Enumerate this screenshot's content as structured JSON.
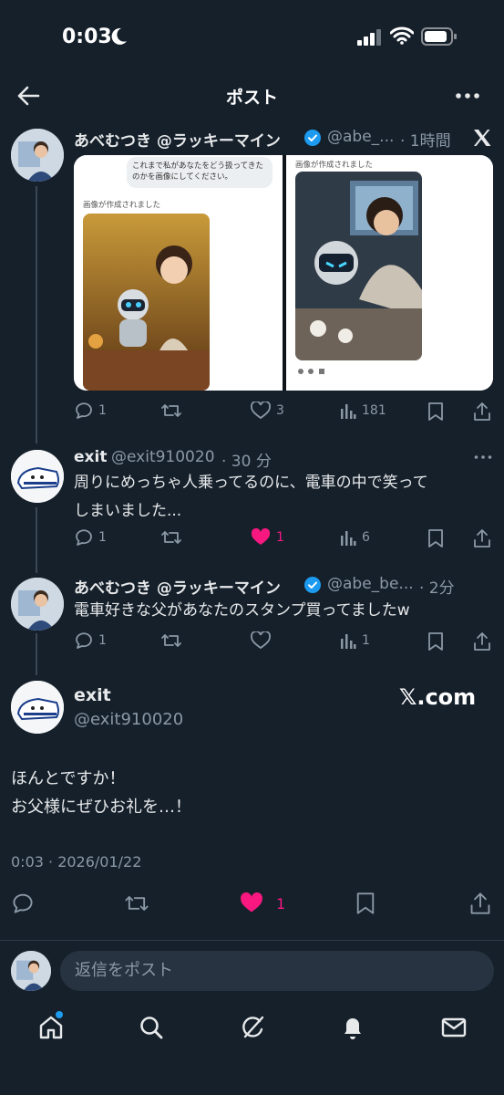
{
  "status_bar": {
    "time": "0:03"
  },
  "header": {
    "title": "ポスト"
  },
  "tweets": [
    {
      "name": "あべむつき @ラッキーマイン",
      "handle": "@abe_...",
      "time": "· 1時間",
      "image": {
        "left_prompt": "これまで私があなたをどう扱ってきたのかを画像にしてください。",
        "left_caption": "画像が作成されました",
        "right_caption": "画像が作成されました"
      },
      "actions": {
        "replies": "1",
        "likes": "3",
        "views": "181"
      }
    },
    {
      "name": "exit",
      "handle": "@exit910020",
      "time": "· 30 分",
      "text_line1": "周りにめっちゃ人乗ってるのに、電車の中で笑って",
      "text_line2": "しまいました...",
      "actions": {
        "replies": "1",
        "likes": "1",
        "views": "6"
      }
    },
    {
      "name": "あべむつき @ラッキーマイン",
      "handle": "@abe_be...",
      "time": "· 2分",
      "text_line1": "電車好きな父があなたのスタンプ買ってましたw",
      "actions": {
        "replies": "1",
        "likes": "",
        "views": "1"
      }
    }
  ],
  "main_post": {
    "name": "exit",
    "handle": "@exit910020",
    "watermark": "𝕏.com",
    "text_line1": "ほんとですか！",
    "text_line2": "お父様にぜひお礼を…！",
    "timestamp": "0:03 · 2026/01/22",
    "likes": "1"
  },
  "reply_box": {
    "placeholder": "返信をポスト"
  },
  "colors": {
    "background": "#15202b",
    "accent": "#1d9bf0",
    "like": "#f91880",
    "muted": "#8b98a5"
  }
}
